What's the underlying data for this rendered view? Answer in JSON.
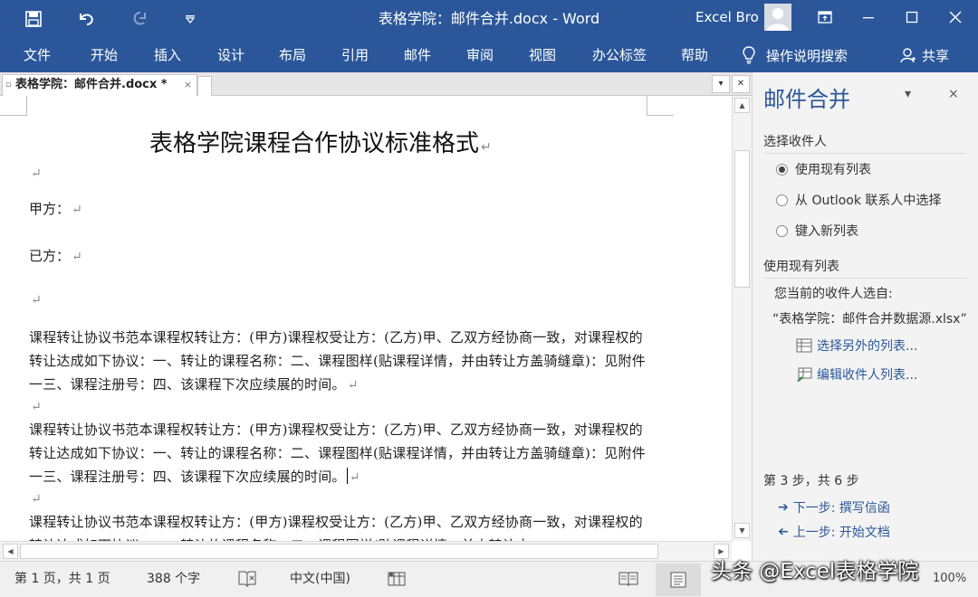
{
  "window": {
    "title": "表格学院：邮件合并.docx  -  Word",
    "user": "Excel Bro"
  },
  "ribbon": {
    "tabs": [
      "文件",
      "开始",
      "插入",
      "设计",
      "布局",
      "引用",
      "邮件",
      "审阅",
      "视图",
      "办公标签",
      "帮助"
    ],
    "tell_me": "操作说明搜索",
    "share": "共享"
  },
  "doc_tab": {
    "label": "表格学院：邮件合并.docx *",
    "close": "×",
    "pin": "▫"
  },
  "document": {
    "title": "表格学院课程合作协议标准格式",
    "mark": "↵",
    "party_a": "甲方：",
    "party_b": "已方：",
    "paragraph_1": "课程转让协议书范本课程权转让方：(甲方)课程权受让方：(乙方)甲、乙双方经协商一致，对课程权的转让达成如下协议：一、转让的课程名称：二、课程图样(贴课程详情，并由转让方盖骑缝章)：见附件一三、课程注册号：四、该课程下次应续展的时间。",
    "paragraph_2": "课程转让协议书范本课程权转让方：(甲方)课程权受让方：(乙方)甲、乙双方经协商一致，对课程权的转让达成如下协议：一、转让的课程名称：二、课程图样(贴课程详情，并由转让方盖骑缝章)：见附件一三、课程注册号：四、该课程下次应续展的时间。",
    "paragraph_3": "课程转让协议书范本课程权转让方：(甲方)课程权受让方：(乙方)甲、乙双方经协商一致，对课程权的转让达成如下协议：一、转让的课程名称：二、课程图样(贴课程详情，并由转让方"
  },
  "mail_merge_pane": {
    "title": "邮件合并",
    "close": "×",
    "menu": "▾",
    "select_recipients_heading": "选择收件人",
    "options": [
      {
        "label": "使用现有列表",
        "selected": true
      },
      {
        "label": "从 Outlook 联系人中选择",
        "selected": false
      },
      {
        "label": "键入新列表",
        "selected": false
      }
    ],
    "use_existing_heading": "使用现有列表",
    "current_from": "您当前的收件人选自:",
    "source_file": "“表格学院：邮件合并数据源.xlsx”",
    "select_other_link": "选择另外的列表...",
    "edit_list_link": "编辑收件人列表...",
    "step_text": "第 3 步，共 6 步",
    "next_link": "下一步: 撰写信函",
    "prev_link": "上一步: 开始文档"
  },
  "status": {
    "page": "第 1 页，共 1 页",
    "words": "388 个字",
    "language": "中文(中国)",
    "zoom": "100%",
    "watermark": "头条 @Excel表格学院"
  },
  "colors": {
    "accent": "#2b579a",
    "pane_bg": "#f3f3f3",
    "status_bg": "#f0f0f0"
  }
}
